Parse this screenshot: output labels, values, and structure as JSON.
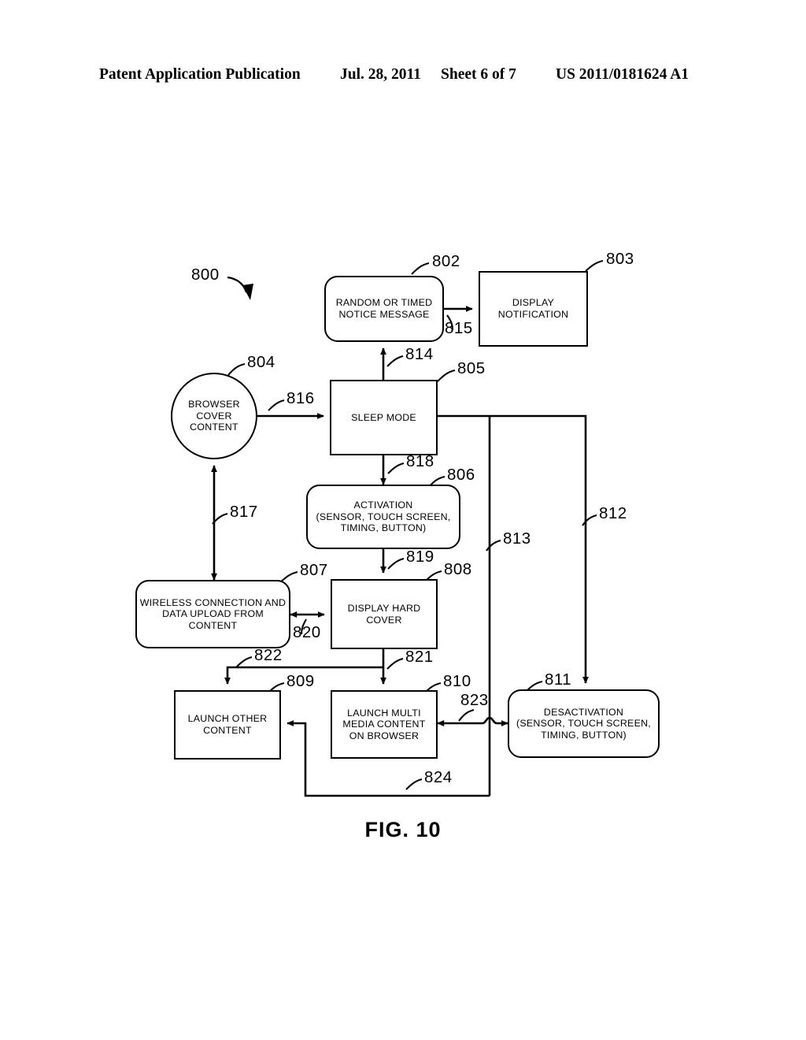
{
  "header": {
    "publication_title": "Patent Application Publication",
    "date": "Jul. 28, 2011",
    "sheet": "Sheet 6 of 7",
    "patent_number": "US 2011/0181624 A1"
  },
  "figure": {
    "caption": "FIG. 10",
    "diagram_ref": "800",
    "nodes": [
      {
        "id": "802",
        "label": "RANDOM OR TIMED\nNOTICE MESSAGE",
        "shape": "rounded-rect"
      },
      {
        "id": "803",
        "label": "DISPLAY\nNOTIFICATION",
        "shape": "rect"
      },
      {
        "id": "804",
        "label": "BROWSER\nCOVER\nCONTENT",
        "shape": "circle"
      },
      {
        "id": "805",
        "label": "SLEEP MODE",
        "shape": "rect"
      },
      {
        "id": "806",
        "label": "ACTIVATION\n(SENSOR, TOUCH SCREEN,\nTIMING, BUTTON)",
        "shape": "rounded-rect"
      },
      {
        "id": "807",
        "label": "WIRELESS CONNECTION AND\nDATA UPLOAD FROM\nCONTENT",
        "shape": "rounded-rect"
      },
      {
        "id": "808",
        "label": "DISPLAY HARD\nCOVER",
        "shape": "rect"
      },
      {
        "id": "809",
        "label": "LAUNCH OTHER\nCONTENT",
        "shape": "rect"
      },
      {
        "id": "810",
        "label": "LAUNCH MULTI\nMEDIA CONTENT\nON BROWSER",
        "shape": "rect"
      },
      {
        "id": "811",
        "label": "DESACTIVATION\n(SENSOR, TOUCH SCREEN,\nTIMING, BUTTON)",
        "shape": "rounded-rect"
      }
    ],
    "connectors": [
      {
        "id": "812",
        "from": "805",
        "to": "811"
      },
      {
        "id": "813",
        "from": "805",
        "to": "823-junction"
      },
      {
        "id": "814",
        "from": "805",
        "to": "802"
      },
      {
        "id": "815",
        "from": "802",
        "to": "803"
      },
      {
        "id": "816",
        "from": "804",
        "to": "805"
      },
      {
        "id": "817",
        "from": "807",
        "to": "804"
      },
      {
        "id": "818",
        "from": "805",
        "to": "806"
      },
      {
        "id": "819",
        "from": "806",
        "to": "808"
      },
      {
        "id": "820",
        "from": "807",
        "to": "808"
      },
      {
        "id": "821",
        "from": "808",
        "to": "810"
      },
      {
        "id": "822",
        "from": "808",
        "to": "809"
      },
      {
        "id": "823",
        "from": "810",
        "to": "811"
      },
      {
        "id": "824",
        "from": "813-line",
        "to": "809"
      }
    ]
  }
}
